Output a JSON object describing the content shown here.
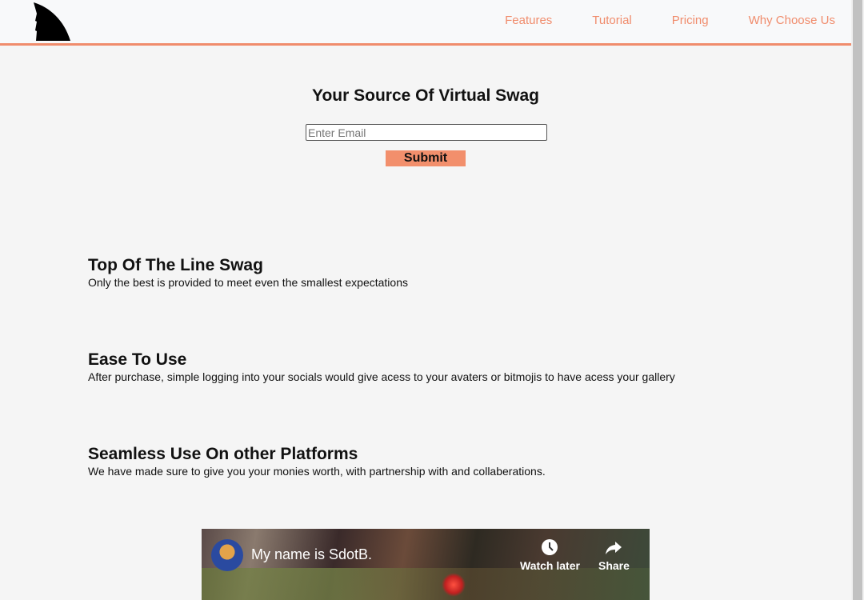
{
  "nav": {
    "items": [
      {
        "label": "Features"
      },
      {
        "label": "Tutorial"
      },
      {
        "label": "Pricing"
      },
      {
        "label": "Why Choose Us"
      }
    ]
  },
  "hero": {
    "title": "Your Source Of Virtual Swag",
    "email_placeholder": "Enter Email",
    "submit_label": "Submit"
  },
  "features": [
    {
      "title": "Top Of The Line Swag",
      "text": "Only the best is provided to meet even the smallest expectations"
    },
    {
      "title": "Ease To Use",
      "text": "After purchase, simple logging into your socials would give acess to your avaters or bitmojis to have acess your gallery"
    },
    {
      "title": "Seamless Use On other Platforms",
      "text": "We have made sure to give you your monies worth, with partnership with and collaberations."
    }
  ],
  "video": {
    "title": "My name is SdotB.",
    "watch_later": "Watch later",
    "share": "Share"
  },
  "colors": {
    "accent": "#f08c6c"
  }
}
